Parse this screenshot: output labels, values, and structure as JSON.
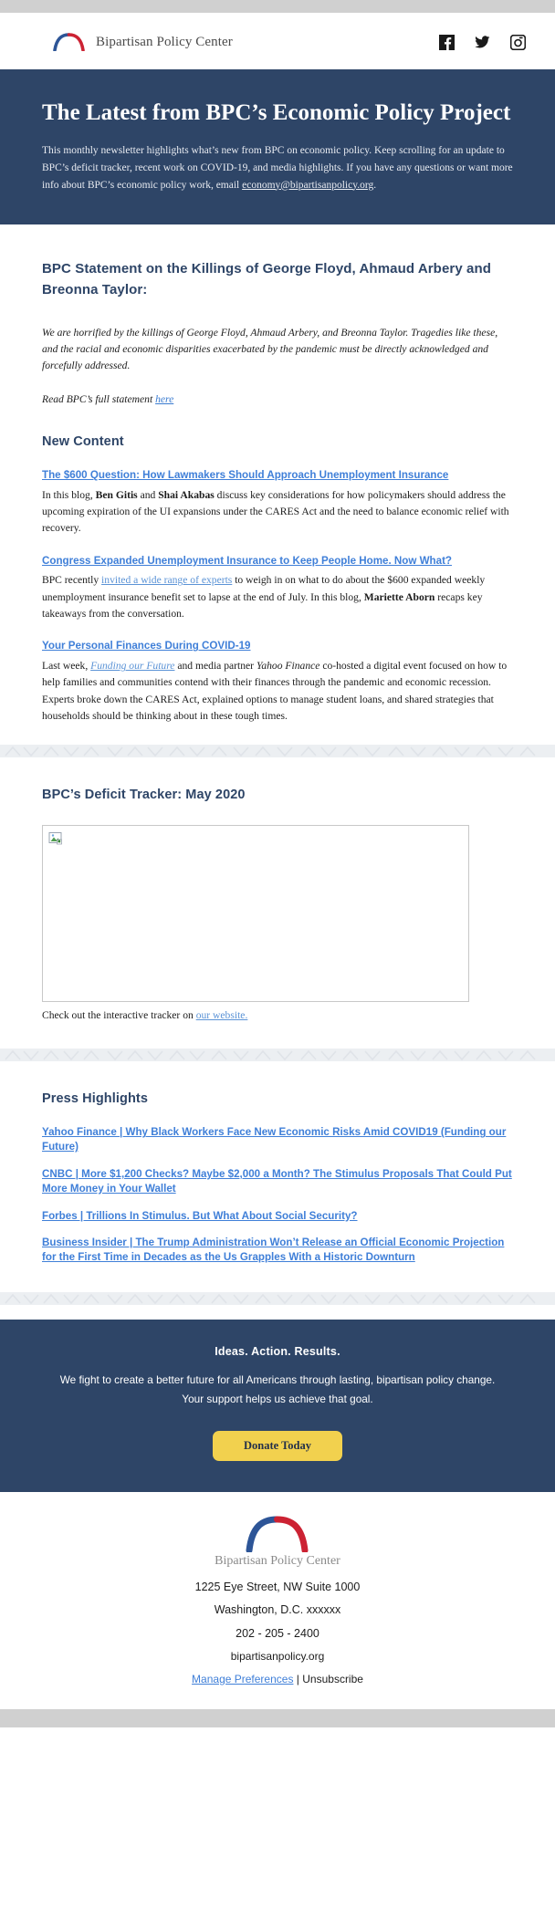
{
  "header": {
    "brand_name": "Bipartisan Policy Center",
    "social": [
      {
        "name": "facebook-icon",
        "label": "Facebook"
      },
      {
        "name": "twitter-icon",
        "label": "Twitter"
      },
      {
        "name": "instagram-icon",
        "label": "Instagram"
      }
    ]
  },
  "hero": {
    "title": "The Latest from BPC’s Economic Policy Project",
    "intro_before_link": "This monthly newsletter highlights what’s new from BPC on economic policy. Keep scrolling for an update to BPC’s deficit tracker, recent work on COVID-19, and media highlights. If you have any questions or want more info about BPC’s economic policy work, email ",
    "intro_link": "economy@bipartisanpolicy.org",
    "intro_after_link": "."
  },
  "statement": {
    "heading": "BPC Statement on the Killings of George Floyd, Ahmaud Arbery and Breonna Taylor:",
    "body": "We are horrified by the killings of George Floyd, Ahmaud Arbery, and Breonna Taylor. Tragedies like these, and the racial and economic disparities exacerbated by the pandemic must be directly acknowledged and forcefully addressed.",
    "read_more_prefix": "Read BPC’s full statement ",
    "read_more_link": "here"
  },
  "new_content": {
    "heading": "New Content",
    "items": [
      {
        "link_title": "The $600 Question: How Lawmakers Should Approach Unemployment Insurance",
        "body_parts": [
          {
            "text": "In this blog, ",
            "style": "normal"
          },
          {
            "text": "Ben Gitis",
            "style": "bold"
          },
          {
            "text": " and ",
            "style": "normal"
          },
          {
            "text": "Shai Akabas",
            "style": "bold"
          },
          {
            "text": " discuss key considerations for how policymakers should address the upcoming expiration of the UI expansions under the CARES Act and the need to balance economic relief with recovery.",
            "style": "normal"
          }
        ]
      },
      {
        "link_title": "Congress Expanded Unemployment Insurance to Keep People Home. Now What?",
        "body_parts": [
          {
            "text": "BPC recently ",
            "style": "normal"
          },
          {
            "text": "invited a wide range of experts",
            "style": "link"
          },
          {
            "text": " to weigh in on what to do about the $600 expanded weekly unemployment insurance benefit set to lapse at the end of July. In this blog, ",
            "style": "normal"
          },
          {
            "text": "Mariette Aborn",
            "style": "bold"
          },
          {
            "text": " recaps key takeaways from the conversation.",
            "style": "normal"
          }
        ]
      },
      {
        "link_title": "Your Personal Finances During COVID-19",
        "body_parts": [
          {
            "text": "Last week, ",
            "style": "normal"
          },
          {
            "text": "Funding our Future",
            "style": "link-italic"
          },
          {
            "text": " and media partner ",
            "style": "normal"
          },
          {
            "text": "Yahoo Finance",
            "style": "italic"
          },
          {
            "text": " co-hosted a digital event focused on how to help families and communities contend with their finances through the pandemic and economic recession. Experts broke down the CARES Act, explained options to manage student loans, and shared strategies that households should be thinking about in these tough times.",
            "style": "normal"
          }
        ]
      }
    ]
  },
  "deficit_tracker": {
    "heading": "BPC’s Deficit Tracker: May 2020",
    "image_alt": "broken-image",
    "caption_prefix": "Check out the interactive tracker on ",
    "caption_link": "our website."
  },
  "press": {
    "heading": "Press Highlights",
    "items": [
      "Yahoo Finance | Why Black Workers Face New Economic Risks Amid COVID19 (Funding our Future)",
      "CNBC | More $1,200 Checks? Maybe $2,000 a Month? The Stimulus Proposals That Could Put More Money in Your Wallet",
      "Forbes | Trillions In Stimulus. But What About Social Security?",
      "Business Insider | The Trump Administration Won’t Release an Official Economic Projection for the First Time in Decades as the Us Grapples With a Historic Downturn"
    ]
  },
  "cta": {
    "tagline": "Ideas. Action. Results.",
    "blurb": "We fight to create a better future for all Americans through lasting, bipartisan policy change. Your support helps us achieve that goal.",
    "button_label": "Donate Today"
  },
  "footer": {
    "brand_name": "Bipartisan Policy Center",
    "address_line1": "1225 Eye Street, NW Suite 1000",
    "address_line2": "Washington, D.C. xxxxxx",
    "phone": "202 - 205 - 2400",
    "website": "bipartisanpolicy.org",
    "manage_link": "Manage Preferences",
    "separator": " | ",
    "unsubscribe": "Unsubscribe"
  },
  "colors": {
    "navy": "#2e4567",
    "link_blue": "#3f7fd8",
    "yellow": "#f2d14e",
    "grey_strip": "#d0d0d0"
  }
}
